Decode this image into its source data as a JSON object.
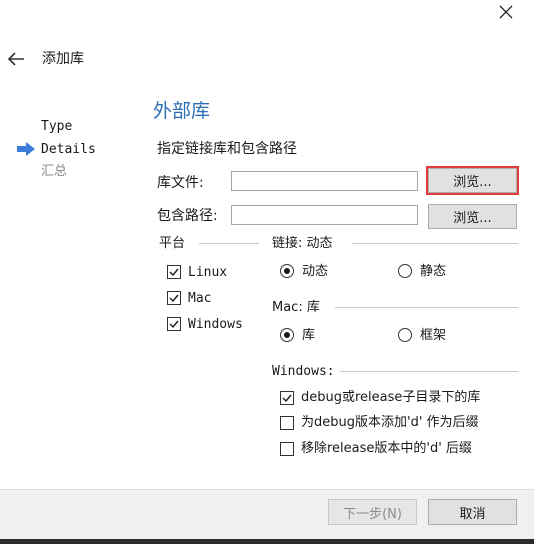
{
  "header": {
    "title": "添加库"
  },
  "steps": [
    {
      "label": "Type",
      "state": "done"
    },
    {
      "label": "Details",
      "state": "current"
    },
    {
      "label": "汇总",
      "state": "pending"
    }
  ],
  "page": {
    "title": "外部库",
    "subtitle": "指定链接库和包含路径"
  },
  "library_file": {
    "label": "库文件:",
    "value": "",
    "browse_label": "浏览..."
  },
  "include_path": {
    "label": "包含路径:",
    "value": "",
    "browse_label": "浏览..."
  },
  "platform": {
    "label": "平台",
    "options": [
      {
        "label": "Linux",
        "checked": true
      },
      {
        "label": "Mac",
        "checked": true
      },
      {
        "label": "Windows",
        "checked": true
      }
    ]
  },
  "linkage": {
    "label": "链接: 动态",
    "options": [
      {
        "label": "动态",
        "selected": true
      },
      {
        "label": "静态",
        "selected": false
      }
    ]
  },
  "mac": {
    "label": "Mac: 库",
    "options": [
      {
        "label": "库",
        "selected": true
      },
      {
        "label": "框架",
        "selected": false
      }
    ]
  },
  "windows": {
    "label": "Windows:",
    "options": [
      {
        "label": "debug或release子目录下的库",
        "checked": true
      },
      {
        "label": "为debug版本添加'd' 作为后缀",
        "checked": false
      },
      {
        "label": "移除release版本中的'd' 后缀",
        "checked": false
      }
    ]
  },
  "footer": {
    "next_label": "下一步(N)",
    "cancel_label": "取消"
  },
  "colors": {
    "accent": "#2c6fb5",
    "arrow": "#3b7dd8",
    "highlight": "#e43a3a"
  }
}
